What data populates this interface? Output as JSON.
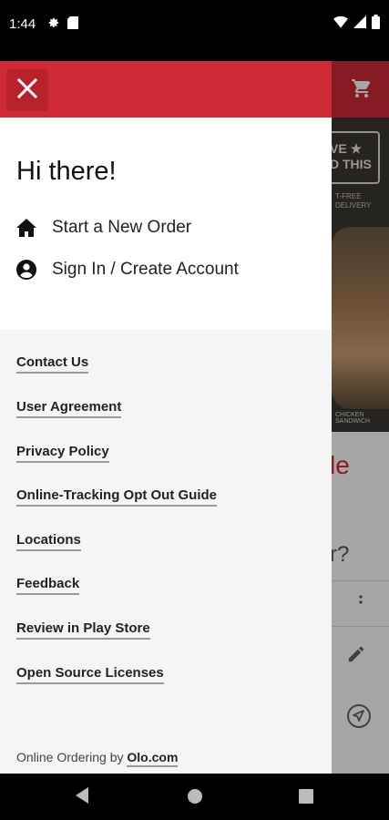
{
  "status_bar": {
    "time": "1:44",
    "left_icons": [
      "gear-icon",
      "sd-card-icon"
    ],
    "right_icons": [
      "wifi-icon",
      "cellular-signal-icon",
      "battery-icon"
    ]
  },
  "background_app": {
    "banner_badge": "VE ★\nD THIS",
    "banner_subtext": "T-FREE\nDELIVERY",
    "banner_caption": "CHICKEN SANDWICH",
    "headline_fragment": "le",
    "question_fragment": "r?",
    "icons": [
      "cart-icon",
      "more-vert-icon",
      "pencil-icon",
      "navigation-icon"
    ]
  },
  "drawer": {
    "header_color": "#d02a36",
    "close_icon": "close-icon",
    "greeting": "Hi there!",
    "menu": [
      {
        "icon": "home-icon",
        "label": "Start a New Order"
      },
      {
        "icon": "account-icon",
        "label": "Sign In / Create Account"
      }
    ],
    "links": [
      "Contact Us",
      "User Agreement",
      "Privacy Policy",
      "Online-Tracking Opt Out Guide",
      "Locations",
      "Feedback",
      "Review in Play Store",
      "Open Source Licenses"
    ],
    "footer": {
      "prefix": "Online Ordering by ",
      "link": "Olo.com"
    }
  },
  "nav_bar": {
    "buttons": [
      "back-icon",
      "home-circle-icon",
      "recents-icon"
    ]
  }
}
